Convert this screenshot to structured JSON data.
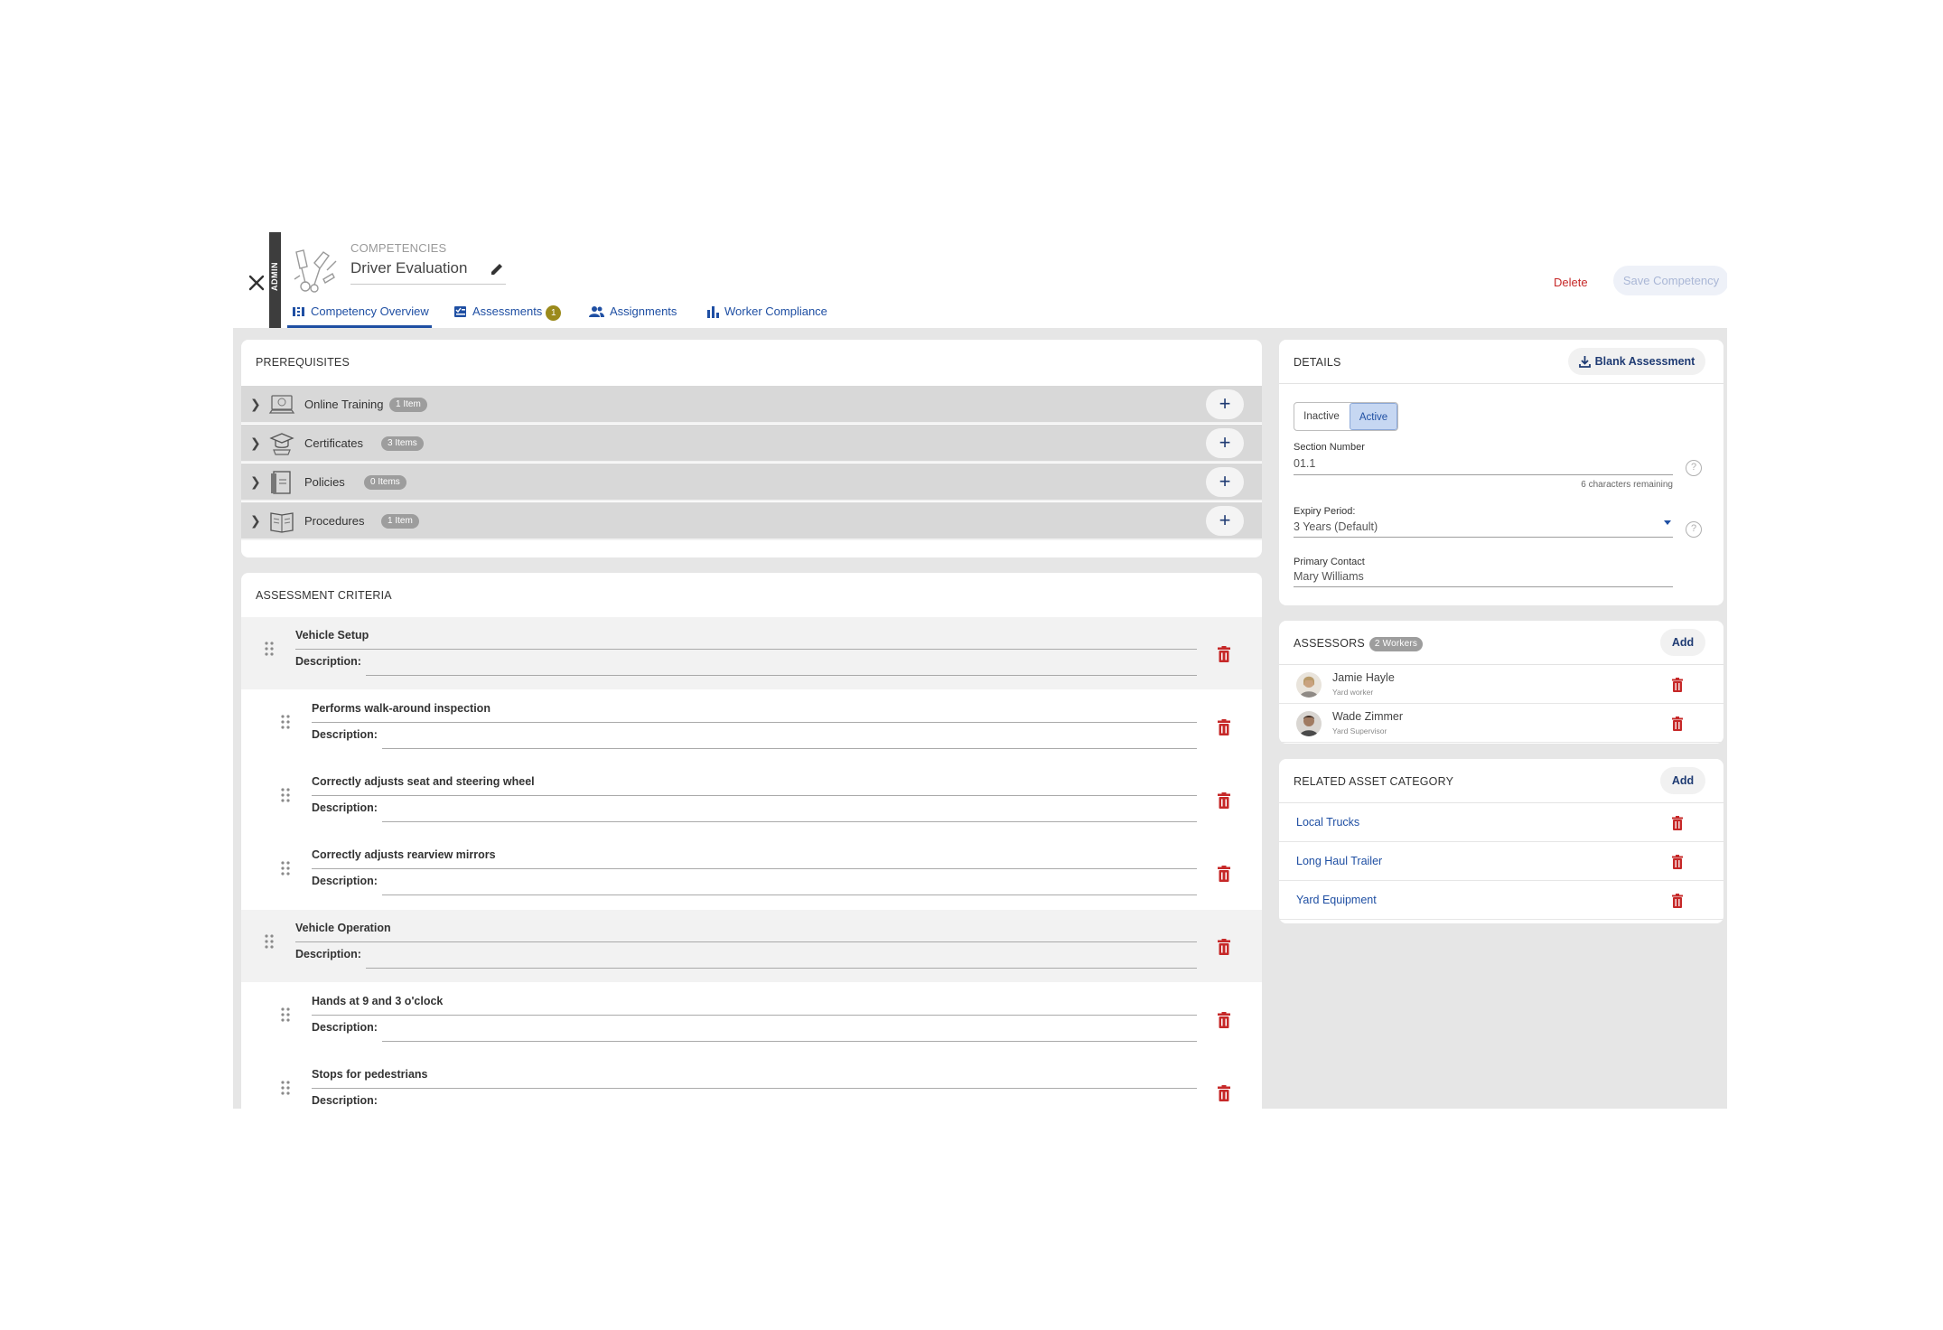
{
  "header": {
    "breadcrumb": "COMPETENCIES",
    "title": "Driver Evaluation",
    "admin_label": "ADMIN",
    "delete_label": "Delete",
    "save_label": "Save Competency"
  },
  "tabs": [
    {
      "label": "Competency Overview",
      "icon": "overview-icon",
      "active": true
    },
    {
      "label": "Assessments",
      "icon": "assessment-icon",
      "badge": "1"
    },
    {
      "label": "Assignments",
      "icon": "people-icon"
    },
    {
      "label": "Worker Compliance",
      "icon": "bar-chart-icon"
    }
  ],
  "prerequisites": {
    "title": "PREREQUISITES",
    "rows": [
      {
        "label": "Online Training",
        "count": "1 Item",
        "icon": "online-training-icon"
      },
      {
        "label": "Certificates",
        "count": "3 Items",
        "icon": "certificate-icon"
      },
      {
        "label": "Policies",
        "count": "0 Items",
        "icon": "policy-icon"
      },
      {
        "label": "Procedures",
        "count": "1 Item",
        "icon": "procedure-icon"
      }
    ]
  },
  "criteria": {
    "title": "ASSESSMENT CRITERIA",
    "description_label": "Description:",
    "rows": [
      {
        "title": "Vehicle Setup",
        "group": true
      },
      {
        "title": "Performs walk-around inspection",
        "group": false
      },
      {
        "title": "Correctly adjusts seat and steering wheel",
        "group": false
      },
      {
        "title": "Correctly adjusts rearview mirrors",
        "group": false
      },
      {
        "title": "Vehicle Operation",
        "group": true
      },
      {
        "title": "Hands at 9 and 3 o'clock",
        "group": false
      },
      {
        "title": "Stops for pedestrians",
        "group": false
      }
    ]
  },
  "details": {
    "title": "DETAILS",
    "blank_assessment_label": "Blank Assessment",
    "status_options": [
      "Inactive",
      "Active"
    ],
    "status_selected": "Active",
    "section_number_label": "Section Number",
    "section_number_value": "01.1",
    "section_number_remaining": "6 characters remaining",
    "expiry_label": "Expiry Period:",
    "expiry_value": "3 Years (Default)",
    "primary_contact_label": "Primary Contact",
    "primary_contact_value": "Mary Williams",
    "help_glyph": "?"
  },
  "assessors": {
    "title": "ASSESSORS",
    "count": "2 Workers",
    "add_label": "Add",
    "people": [
      {
        "name": "Jamie Hayle",
        "role": "Yard worker"
      },
      {
        "name": "Wade Zimmer",
        "role": "Yard Supervisor"
      }
    ]
  },
  "related_assets": {
    "title": "RELATED ASSET CATEGORY",
    "add_label": "Add",
    "items": [
      "Local Trucks",
      "Long Haul Trailer",
      "Yard Equipment"
    ]
  },
  "colors": {
    "accent": "#1f4fa3",
    "danger": "#c62828",
    "badge_gold": "#9b8a1b"
  }
}
